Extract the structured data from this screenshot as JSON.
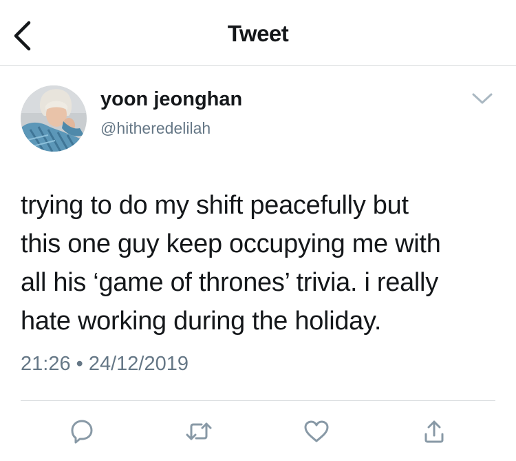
{
  "header": {
    "title": "Tweet",
    "back_icon": "chevron-left-icon"
  },
  "author": {
    "display_name": "yoon jeonghan",
    "handle": "@hitheredelilah",
    "avatar_icon": "avatar-photo"
  },
  "tweet": {
    "text": "trying to do my shift peacefully but\nthis one guy keep occupying me with\nall his ‘game of thrones’ trivia. i really\nhate working during the holiday.",
    "timestamp": "21:26 • 24/12/2019"
  },
  "actions": [
    {
      "name": "reply",
      "icon": "reply-icon"
    },
    {
      "name": "retweet",
      "icon": "retweet-icon"
    },
    {
      "name": "like",
      "icon": "heart-icon"
    },
    {
      "name": "share",
      "icon": "share-icon"
    }
  ],
  "colors": {
    "text_primary": "#14171a",
    "text_secondary": "#657786",
    "icon_gray": "#8899a6",
    "divider": "#d6d9db"
  }
}
